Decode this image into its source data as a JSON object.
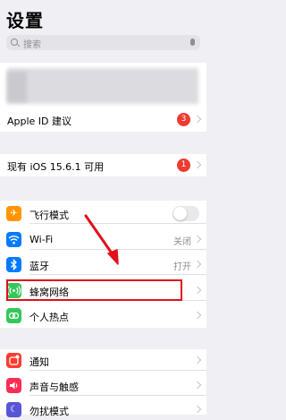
{
  "header": {
    "title": "设置"
  },
  "search": {
    "placeholder": "搜索"
  },
  "account": {
    "apple_id_label": "Apple ID 建议",
    "apple_id_badge": "3"
  },
  "update": {
    "label": "现有 iOS 15.6.1 可用",
    "badge": "1"
  },
  "network": {
    "items": [
      {
        "label": "飞行模式",
        "icon": "airplane-icon",
        "color": "#ff9500",
        "toggle": false
      },
      {
        "label": "Wi-Fi",
        "icon": "wifi-icon",
        "color": "#007aff",
        "value": "关闭"
      },
      {
        "label": "蓝牙",
        "icon": "bluetooth-icon",
        "color": "#007aff",
        "value": "打开"
      },
      {
        "label": "蜂窝网络",
        "icon": "cellular-icon",
        "color": "#34c759"
      },
      {
        "label": "个人热点",
        "icon": "hotspot-icon",
        "color": "#34c759"
      }
    ]
  },
  "notifications": {
    "items": [
      {
        "label": "通知",
        "icon": "notifications-icon",
        "color": "#ff3b30"
      },
      {
        "label": "声音与触感",
        "icon": "sounds-icon",
        "color": "#ff2d55"
      },
      {
        "label": "勿扰模式",
        "icon": "do-not-disturb-icon",
        "color": "#5856d6"
      }
    ]
  },
  "annotation": {
    "color": "#e1101a"
  }
}
